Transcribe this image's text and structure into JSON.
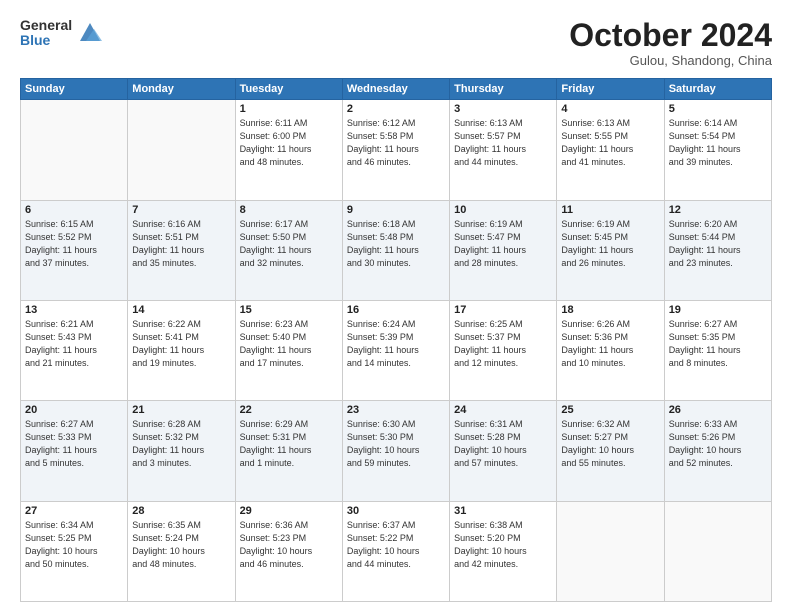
{
  "header": {
    "logo_general": "General",
    "logo_blue": "Blue",
    "month_title": "October 2024",
    "subtitle": "Gulou, Shandong, China"
  },
  "days_of_week": [
    "Sunday",
    "Monday",
    "Tuesday",
    "Wednesday",
    "Thursday",
    "Friday",
    "Saturday"
  ],
  "weeks": [
    [
      {
        "day": "",
        "info": ""
      },
      {
        "day": "",
        "info": ""
      },
      {
        "day": "1",
        "info": "Sunrise: 6:11 AM\nSunset: 6:00 PM\nDaylight: 11 hours\nand 48 minutes."
      },
      {
        "day": "2",
        "info": "Sunrise: 6:12 AM\nSunset: 5:58 PM\nDaylight: 11 hours\nand 46 minutes."
      },
      {
        "day": "3",
        "info": "Sunrise: 6:13 AM\nSunset: 5:57 PM\nDaylight: 11 hours\nand 44 minutes."
      },
      {
        "day": "4",
        "info": "Sunrise: 6:13 AM\nSunset: 5:55 PM\nDaylight: 11 hours\nand 41 minutes."
      },
      {
        "day": "5",
        "info": "Sunrise: 6:14 AM\nSunset: 5:54 PM\nDaylight: 11 hours\nand 39 minutes."
      }
    ],
    [
      {
        "day": "6",
        "info": "Sunrise: 6:15 AM\nSunset: 5:52 PM\nDaylight: 11 hours\nand 37 minutes."
      },
      {
        "day": "7",
        "info": "Sunrise: 6:16 AM\nSunset: 5:51 PM\nDaylight: 11 hours\nand 35 minutes."
      },
      {
        "day": "8",
        "info": "Sunrise: 6:17 AM\nSunset: 5:50 PM\nDaylight: 11 hours\nand 32 minutes."
      },
      {
        "day": "9",
        "info": "Sunrise: 6:18 AM\nSunset: 5:48 PM\nDaylight: 11 hours\nand 30 minutes."
      },
      {
        "day": "10",
        "info": "Sunrise: 6:19 AM\nSunset: 5:47 PM\nDaylight: 11 hours\nand 28 minutes."
      },
      {
        "day": "11",
        "info": "Sunrise: 6:19 AM\nSunset: 5:45 PM\nDaylight: 11 hours\nand 26 minutes."
      },
      {
        "day": "12",
        "info": "Sunrise: 6:20 AM\nSunset: 5:44 PM\nDaylight: 11 hours\nand 23 minutes."
      }
    ],
    [
      {
        "day": "13",
        "info": "Sunrise: 6:21 AM\nSunset: 5:43 PM\nDaylight: 11 hours\nand 21 minutes."
      },
      {
        "day": "14",
        "info": "Sunrise: 6:22 AM\nSunset: 5:41 PM\nDaylight: 11 hours\nand 19 minutes."
      },
      {
        "day": "15",
        "info": "Sunrise: 6:23 AM\nSunset: 5:40 PM\nDaylight: 11 hours\nand 17 minutes."
      },
      {
        "day": "16",
        "info": "Sunrise: 6:24 AM\nSunset: 5:39 PM\nDaylight: 11 hours\nand 14 minutes."
      },
      {
        "day": "17",
        "info": "Sunrise: 6:25 AM\nSunset: 5:37 PM\nDaylight: 11 hours\nand 12 minutes."
      },
      {
        "day": "18",
        "info": "Sunrise: 6:26 AM\nSunset: 5:36 PM\nDaylight: 11 hours\nand 10 minutes."
      },
      {
        "day": "19",
        "info": "Sunrise: 6:27 AM\nSunset: 5:35 PM\nDaylight: 11 hours\nand 8 minutes."
      }
    ],
    [
      {
        "day": "20",
        "info": "Sunrise: 6:27 AM\nSunset: 5:33 PM\nDaylight: 11 hours\nand 5 minutes."
      },
      {
        "day": "21",
        "info": "Sunrise: 6:28 AM\nSunset: 5:32 PM\nDaylight: 11 hours\nand 3 minutes."
      },
      {
        "day": "22",
        "info": "Sunrise: 6:29 AM\nSunset: 5:31 PM\nDaylight: 11 hours\nand 1 minute."
      },
      {
        "day": "23",
        "info": "Sunrise: 6:30 AM\nSunset: 5:30 PM\nDaylight: 10 hours\nand 59 minutes."
      },
      {
        "day": "24",
        "info": "Sunrise: 6:31 AM\nSunset: 5:28 PM\nDaylight: 10 hours\nand 57 minutes."
      },
      {
        "day": "25",
        "info": "Sunrise: 6:32 AM\nSunset: 5:27 PM\nDaylight: 10 hours\nand 55 minutes."
      },
      {
        "day": "26",
        "info": "Sunrise: 6:33 AM\nSunset: 5:26 PM\nDaylight: 10 hours\nand 52 minutes."
      }
    ],
    [
      {
        "day": "27",
        "info": "Sunrise: 6:34 AM\nSunset: 5:25 PM\nDaylight: 10 hours\nand 50 minutes."
      },
      {
        "day": "28",
        "info": "Sunrise: 6:35 AM\nSunset: 5:24 PM\nDaylight: 10 hours\nand 48 minutes."
      },
      {
        "day": "29",
        "info": "Sunrise: 6:36 AM\nSunset: 5:23 PM\nDaylight: 10 hours\nand 46 minutes."
      },
      {
        "day": "30",
        "info": "Sunrise: 6:37 AM\nSunset: 5:22 PM\nDaylight: 10 hours\nand 44 minutes."
      },
      {
        "day": "31",
        "info": "Sunrise: 6:38 AM\nSunset: 5:20 PM\nDaylight: 10 hours\nand 42 minutes."
      },
      {
        "day": "",
        "info": ""
      },
      {
        "day": "",
        "info": ""
      }
    ]
  ]
}
